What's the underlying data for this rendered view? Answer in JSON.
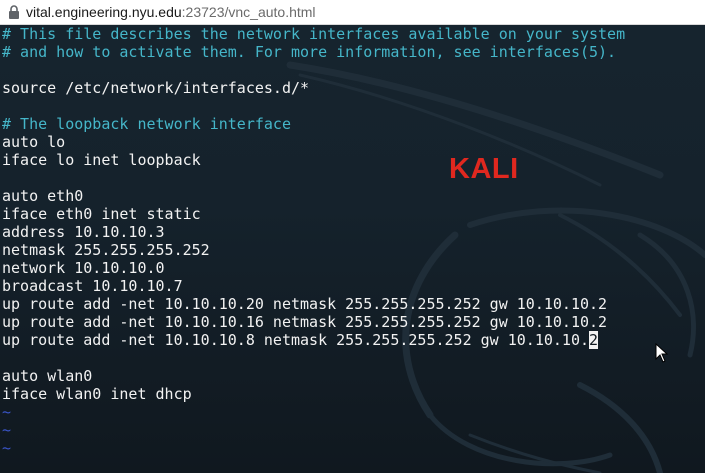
{
  "browser": {
    "url_host": "vital.engineering.nyu.edu",
    "url_rest": ":23723/vnc_auto.html"
  },
  "wallpaper": {
    "label": "KALI",
    "label_color": "#e0281f"
  },
  "colors": {
    "background": "#15222c",
    "comment": "#45b6c9",
    "text": "#f2f2f2",
    "tilde": "#3a55c8"
  },
  "editor": {
    "lines": [
      {
        "kind": "comment",
        "text": "# This file describes the network interfaces available on your system"
      },
      {
        "kind": "comment",
        "text": "# and how to activate them. For more information, see interfaces(5)."
      },
      {
        "kind": "blank",
        "text": ""
      },
      {
        "kind": "text",
        "text": "source /etc/network/interfaces.d/*"
      },
      {
        "kind": "blank",
        "text": ""
      },
      {
        "kind": "comment",
        "text": "# The loopback network interface"
      },
      {
        "kind": "text",
        "text": "auto lo"
      },
      {
        "kind": "text",
        "text": "iface lo inet loopback"
      },
      {
        "kind": "blank",
        "text": ""
      },
      {
        "kind": "text",
        "text": "auto eth0"
      },
      {
        "kind": "text",
        "text": "iface eth0 inet static"
      },
      {
        "kind": "text",
        "text": "address 10.10.10.3"
      },
      {
        "kind": "text",
        "text": "netmask 255.255.255.252"
      },
      {
        "kind": "text",
        "text": "network 10.10.10.0"
      },
      {
        "kind": "text",
        "text": "broadcast 10.10.10.7"
      },
      {
        "kind": "text",
        "text": "up route add -net 10.10.10.20 netmask 255.255.255.252 gw 10.10.10.2"
      },
      {
        "kind": "text",
        "text": "up route add -net 10.10.10.16 netmask 255.255.255.252 gw 10.10.10.2"
      },
      {
        "kind": "text",
        "text": "up route add -net 10.10.10.8 netmask 255.255.255.252 gw 10.10.10.",
        "cursor": "2"
      },
      {
        "kind": "blank",
        "text": ""
      },
      {
        "kind": "text",
        "text": "auto wlan0"
      },
      {
        "kind": "text",
        "text": "iface wlan0 inet dhcp"
      },
      {
        "kind": "tilde",
        "text": "~"
      },
      {
        "kind": "tilde",
        "text": "~"
      },
      {
        "kind": "tilde",
        "text": "~"
      }
    ]
  }
}
